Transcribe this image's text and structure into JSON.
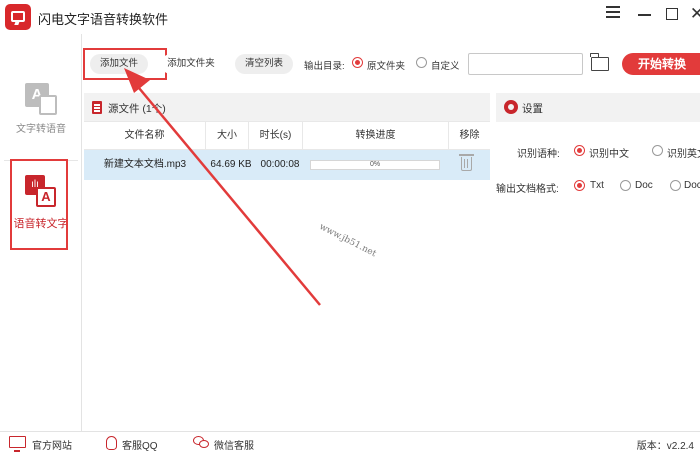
{
  "app": {
    "title": "闪电文字语音转换软件"
  },
  "sidebar": {
    "items": [
      {
        "label": "文字转语音",
        "active": false
      },
      {
        "label": "语音转文字",
        "active": true
      }
    ]
  },
  "toolbar": {
    "add_file_label": "添加文件",
    "add_folder_label": "添加文件夹",
    "clear_list_label": "清空列表",
    "output_dir_label": "输出目录:",
    "output_options": [
      {
        "label": "原文件夹",
        "selected": true
      },
      {
        "label": "自定义",
        "selected": false
      }
    ],
    "path_value": "",
    "start_label": "开始转换"
  },
  "file_list": {
    "title": "源文件 (1个)",
    "columns": [
      "文件名称",
      "大小",
      "时长(s)",
      "转换进度",
      "移除"
    ],
    "rows": [
      {
        "name": "新建文本文档.mp3",
        "size": "64.69 KB",
        "duration": "00:00:08",
        "progress_text": "0%",
        "progress_fraction": 0
      }
    ]
  },
  "settings": {
    "title": "设置",
    "language_label": "识别语种:",
    "language_options": [
      {
        "label": "识别中文",
        "selected": true
      },
      {
        "label": "识别英文",
        "selected": false
      }
    ],
    "format_label": "输出文档格式:",
    "format_options": [
      {
        "label": "Txt",
        "selected": true
      },
      {
        "label": "Doc",
        "selected": false
      },
      {
        "label": "Doc",
        "selected": false
      }
    ]
  },
  "watermark": "www.jb51.net",
  "footer": {
    "website_label": "官方网站",
    "qq_label": "客服QQ",
    "wechat_label": "微信客服",
    "version": "版本：v2.2.4"
  },
  "colors": {
    "accent": "#e23b3b",
    "accent_dark": "#c8262c",
    "selected_row": "#d9ebf8"
  }
}
